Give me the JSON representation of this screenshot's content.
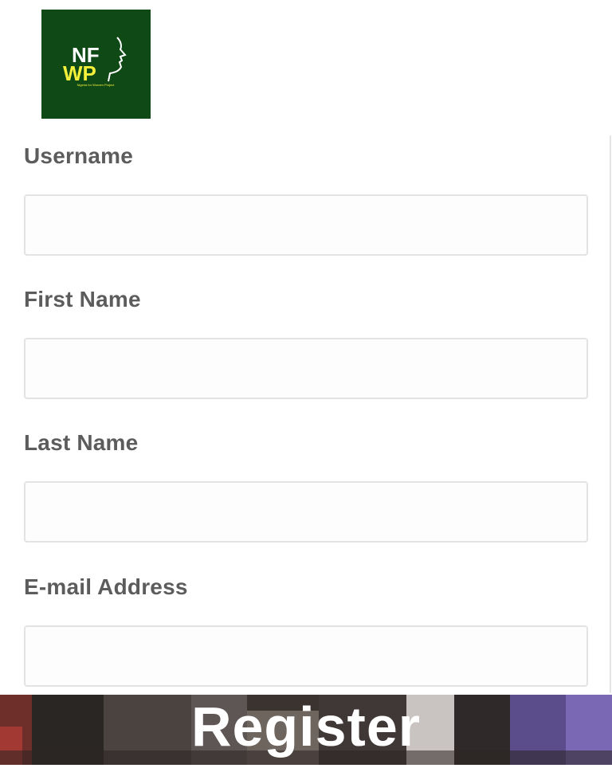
{
  "logo": {
    "line1": "NF",
    "line2": "WP",
    "tagline": "Nigeria for Women Project",
    "background_color": "#0f4a16",
    "text_color": "#ffffff",
    "accent_color": "#f3ef3a"
  },
  "form": {
    "fields": [
      {
        "label": "Username",
        "value": "",
        "placeholder": ""
      },
      {
        "label": "First Name",
        "value": "",
        "placeholder": ""
      },
      {
        "label": "Last Name",
        "value": "",
        "placeholder": ""
      },
      {
        "label": "E-mail Address",
        "value": "",
        "placeholder": ""
      }
    ]
  },
  "register_button": {
    "label": "Register",
    "text_color": "#ffffff"
  }
}
